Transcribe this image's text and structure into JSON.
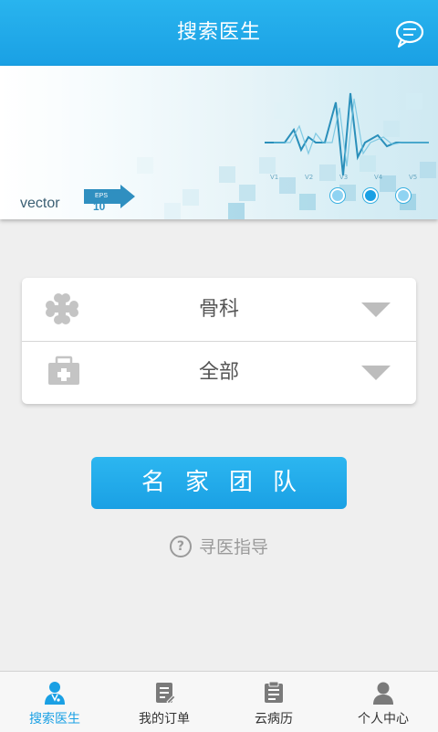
{
  "header": {
    "title": "搜索医生",
    "chat_icon": "chat-bubble-icon"
  },
  "banner": {
    "logo_text": "vector",
    "logo_badge_top": "EPS",
    "logo_badge_num": "10",
    "slide_count": 3,
    "active_slide": 2,
    "wave_labels": [
      "V1",
      "V2",
      "V3",
      "V4",
      "V5"
    ]
  },
  "selector": {
    "department": {
      "value": "骨科",
      "icon": "bone-icon"
    },
    "category": {
      "value": "全部",
      "icon": "medical-kit-icon"
    }
  },
  "team_button": {
    "label": "名家团队"
  },
  "guide": {
    "icon": "?",
    "label": "寻医指导"
  },
  "tabs": [
    {
      "label": "搜索医生",
      "icon": "doctor-icon",
      "active": true
    },
    {
      "label": "我的订单",
      "icon": "order-icon",
      "active": false
    },
    {
      "label": "云病历",
      "icon": "medical-record-icon",
      "active": false
    },
    {
      "label": "个人中心",
      "icon": "person-icon",
      "active": false
    }
  ],
  "colors": {
    "accent": "#1aa0e4",
    "inactive": "#9a9a9a"
  }
}
